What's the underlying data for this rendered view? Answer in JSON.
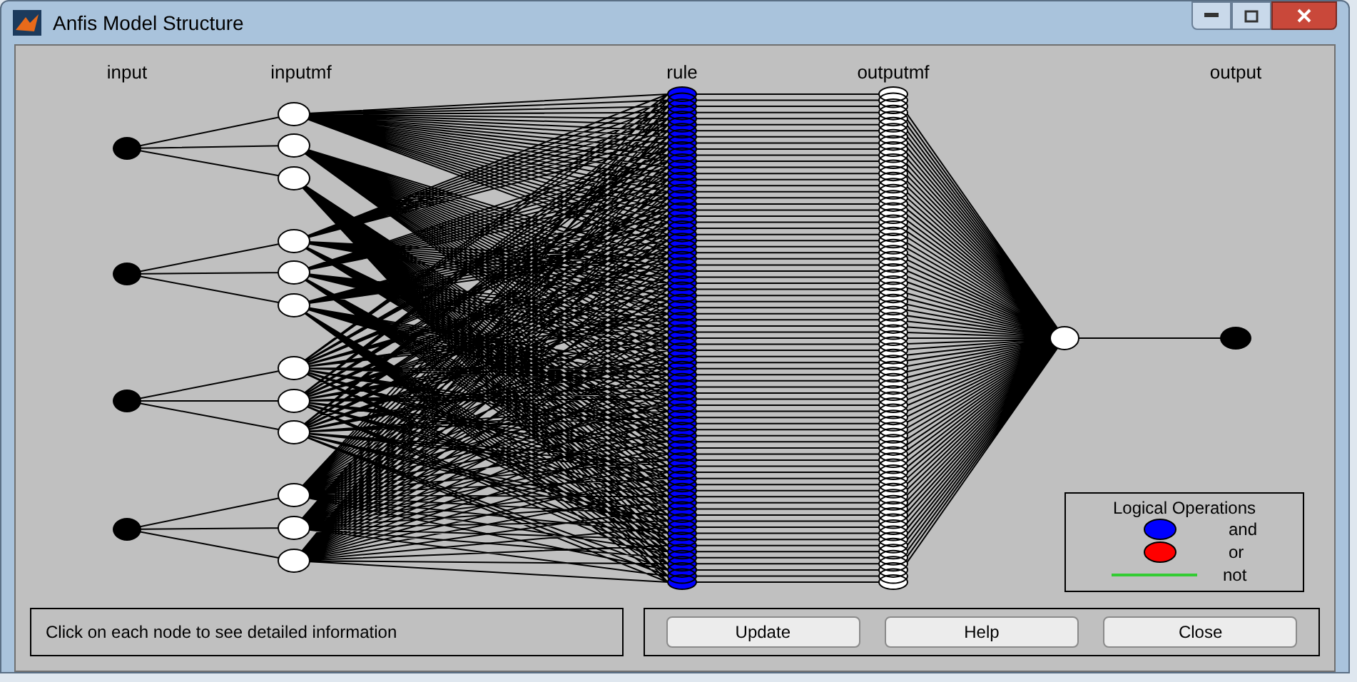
{
  "window": {
    "title": "Anfis Model Structure"
  },
  "diagram": {
    "layers": [
      {
        "label": "input",
        "kind": "input"
      },
      {
        "label": "inputmf",
        "kind": "inputmf"
      },
      {
        "label": "rule",
        "kind": "rule"
      },
      {
        "label": "outputmf",
        "kind": "outputmf"
      },
      {
        "label": "output",
        "kind": "output"
      }
    ]
  },
  "legend": {
    "title": "Logical Operations",
    "items": [
      {
        "label": "and",
        "kind": "dot",
        "color": "#0000ff"
      },
      {
        "label": "or",
        "kind": "dot",
        "color": "#ff0000"
      },
      {
        "label": "not",
        "kind": "line",
        "color": "#33cc33"
      }
    ]
  },
  "status": "Click on each node to see detailed information",
  "buttons": [
    "Update",
    "Help",
    "Close"
  ]
}
